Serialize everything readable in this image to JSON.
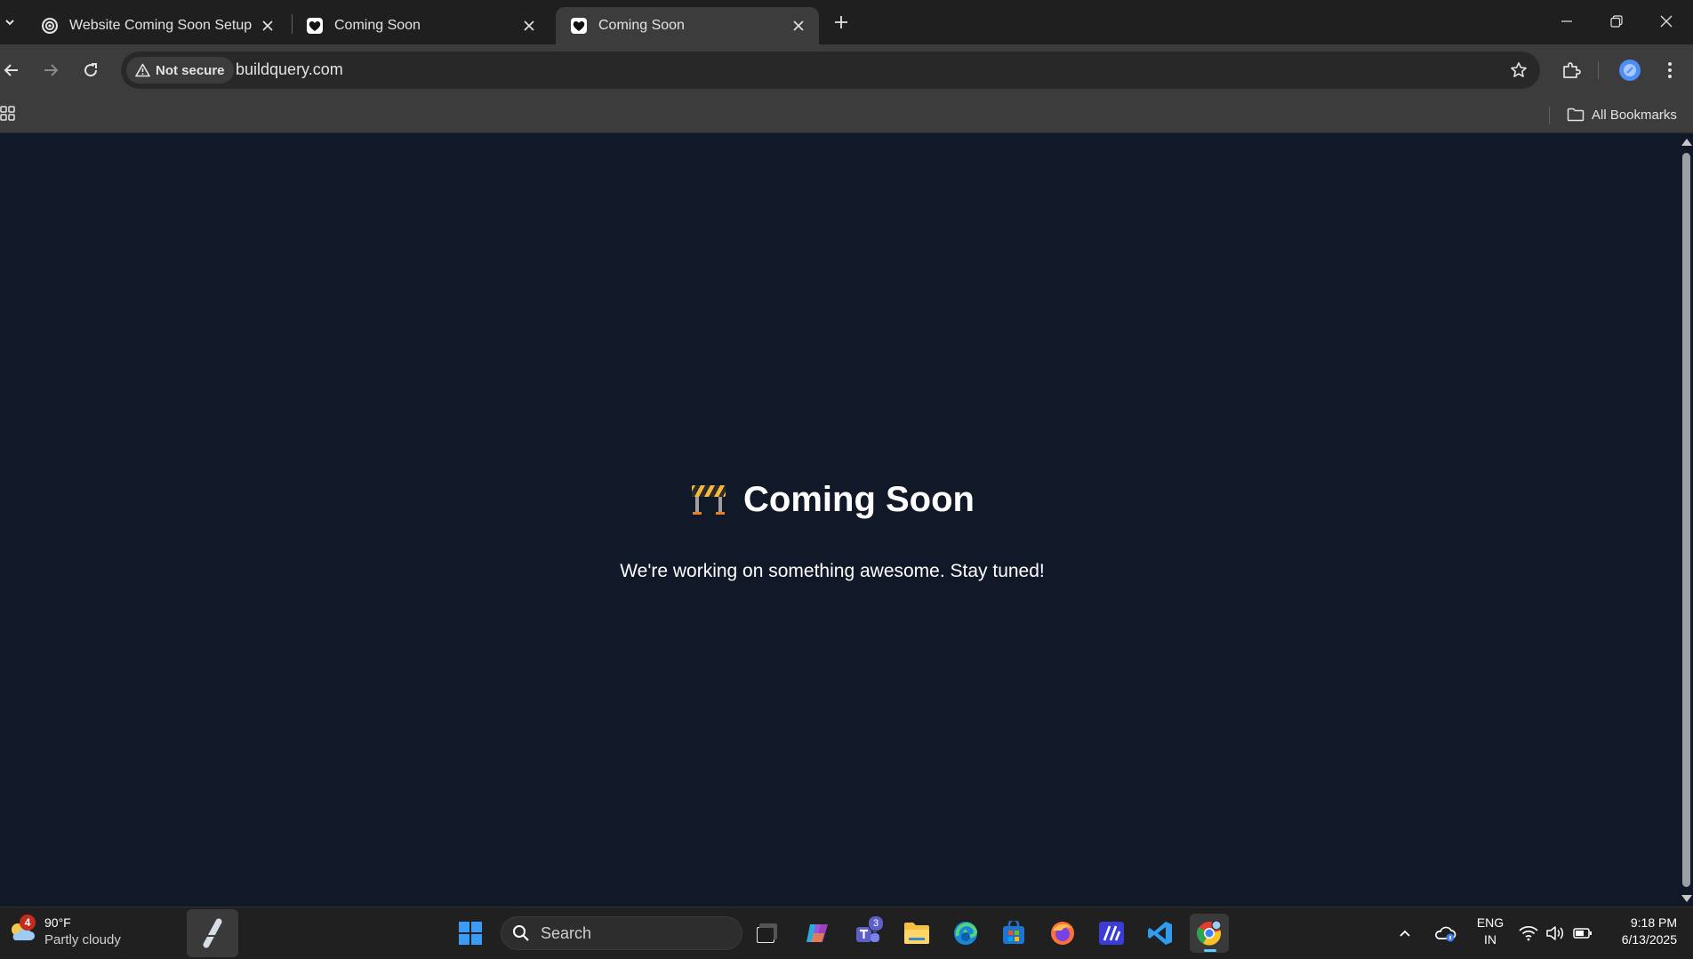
{
  "browser": {
    "tabs": [
      {
        "title": "Website Coming Soon Setup",
        "icon": "openai-icon",
        "active": false
      },
      {
        "title": "Coming Soon",
        "icon": "heart-icon",
        "active": false
      },
      {
        "title": "Coming Soon",
        "icon": "heart-icon",
        "active": true
      }
    ],
    "security_label": "Not secure",
    "url": "buildquery.com",
    "bookmarks_label": "All Bookmarks"
  },
  "page": {
    "emoji": "🚧",
    "title": "Coming Soon",
    "subtitle": "We're working on something awesome. Stay tuned!"
  },
  "taskbar": {
    "weather": {
      "temp": "90°F",
      "desc": "Partly cloudy",
      "badge": "4"
    },
    "search_placeholder": "Search",
    "teams_badge": "3",
    "language": {
      "line1": "ENG",
      "line2": "IN"
    },
    "clock": {
      "time": "9:18 PM",
      "date": "6/13/2025"
    }
  },
  "colors": {
    "page_background": "#111827",
    "accent": "#60cdff"
  }
}
